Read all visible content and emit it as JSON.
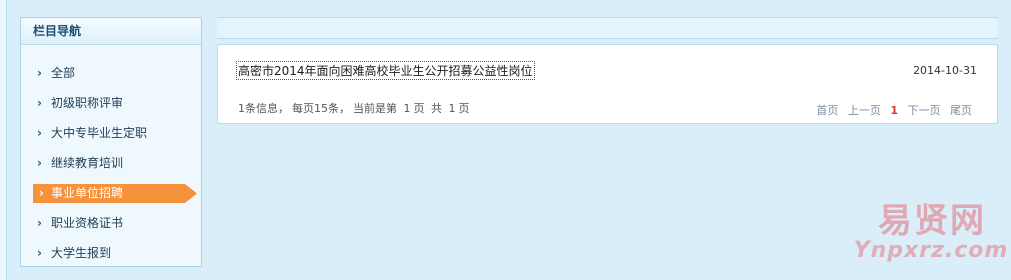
{
  "sidebar": {
    "title": "栏目导航",
    "items": [
      {
        "label": "全部"
      },
      {
        "label": "初级职称评审"
      },
      {
        "label": "大中专毕业生定职"
      },
      {
        "label": "继续教育培训"
      },
      {
        "label": "事业单位招聘",
        "active": true
      },
      {
        "label": "职业资格证书"
      },
      {
        "label": "大学生报到"
      }
    ],
    "arrow_glyph": "›"
  },
  "list": {
    "items": [
      {
        "title": "高密市2014年面向困难高校毕业生公开招募公益性岗位",
        "date": "2014-10-31"
      }
    ]
  },
  "summary": {
    "count": "1条信息，",
    "per_page": "每页15条，",
    "current_prefix": "当前是第",
    "current_page": "1",
    "page_unit": "页",
    "total_prefix": "共",
    "total_pages": "1",
    "total_unit": "页"
  },
  "pager": {
    "first": "首页",
    "prev": "上一页",
    "current": "1",
    "next": "下一页",
    "last": "尾页"
  },
  "watermark": {
    "main": "易贤网",
    "sub": "Ynpxrz.com"
  },
  "colors": {
    "active_item": "#f6923c",
    "background": "#d9eef8",
    "border": "#b9dcec"
  }
}
